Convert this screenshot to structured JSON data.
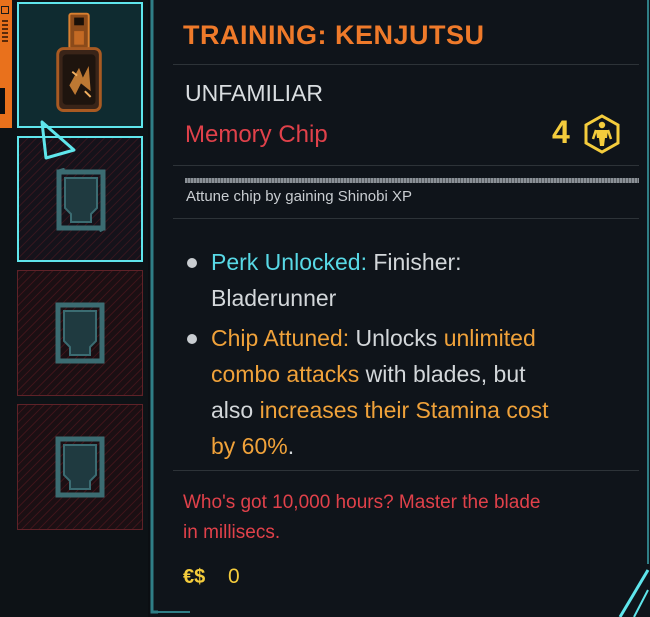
{
  "item": {
    "title": "TRAINING: KENJUTSU",
    "rarity": "UNFAMILIAR",
    "type": "Memory Chip",
    "tier": "4",
    "tier_icon": "body-figure-icon",
    "attunement_progress": 1.0,
    "attune_hint": "Attune chip by gaining Shinobi XP",
    "stats": [
      {
        "label": "Perk Unlocked:",
        "text_line1": " Finisher:",
        "text_line2": "Bladerunner"
      },
      {
        "label": "Chip Attuned:",
        "seg1": " Unlocks ",
        "hl1": "unlimited",
        "hl2": "combo attacks",
        "seg2": " with blades, but",
        "seg3": "also ",
        "hl3": "increases their Stamina cost",
        "hl4": "by 60%",
        "seg4": "."
      }
    ],
    "flavor_line1": "Who's got 10,000 hours? Master the blade",
    "flavor_line2": "in millisecs.",
    "price_icon": "€$",
    "price": "0"
  },
  "slots": [
    {
      "state": "equipped",
      "icon": "memory-chip-icon"
    },
    {
      "state": "empty-selected",
      "icon": "empty-chip-slot-icon"
    },
    {
      "state": "empty",
      "icon": "empty-chip-slot-icon"
    },
    {
      "state": "empty",
      "icon": "empty-chip-slot-icon"
    }
  ],
  "colors": {
    "title": "#ef7a2a",
    "accent_cyan": "#5fe6ec",
    "item_type": "#e0414a",
    "tier": "#f4cc3c",
    "highlight": "#f0a23a"
  }
}
